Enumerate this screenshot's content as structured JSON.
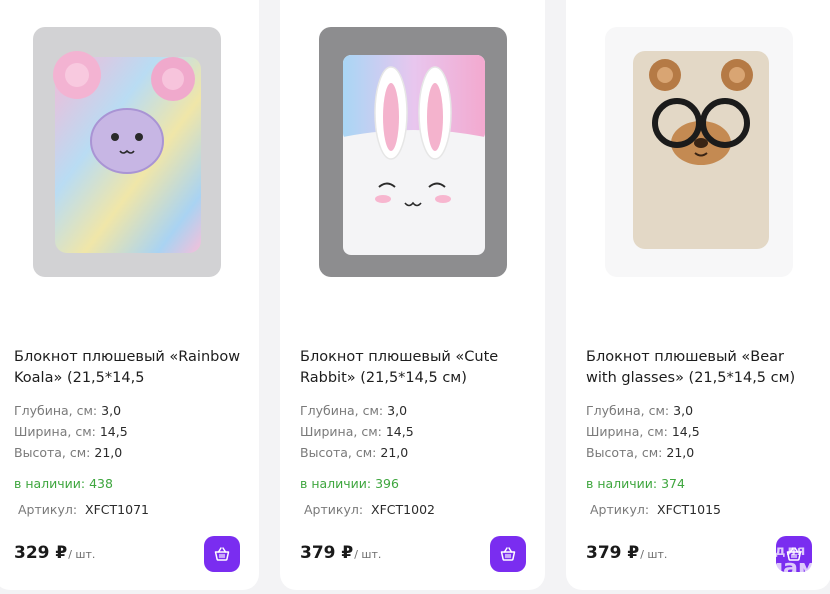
{
  "products": [
    {
      "image_icon": "notebook-rainbow-koala-image",
      "title": "Блокнот плюшевый «Rainbow Koala» (21,5*14,5",
      "specs": [
        {
          "label": "Глубина, см:",
          "value": "3,0"
        },
        {
          "label": "Ширина, см:",
          "value": "14,5"
        },
        {
          "label": "Высота, см:",
          "value": "21,0"
        }
      ],
      "stock": "в наличии: 438",
      "article_label": "Артикул:",
      "article": "XFCT1071",
      "price": "329 ₽",
      "unit": "/ шт."
    },
    {
      "image_icon": "notebook-cute-rabbit-image",
      "title": "Блокнот плюшевый «Cute Rabbit» (21,5*14,5 см)",
      "specs": [
        {
          "label": "Глубина, см:",
          "value": "3,0"
        },
        {
          "label": "Ширина, см:",
          "value": "14,5"
        },
        {
          "label": "Высота, см:",
          "value": "21,0"
        }
      ],
      "stock": "в наличии: 396",
      "article_label": "Артикул:",
      "article": "XFCT1002",
      "price": "379 ₽",
      "unit": "/ шт."
    },
    {
      "image_icon": "notebook-bear-with-glasses-image",
      "title": "Блокнот плюшевый «Bear with glasses» (21,5*14,5 см)",
      "specs": [
        {
          "label": "Глубина, см:",
          "value": "3,0"
        },
        {
          "label": "Ширина, см:",
          "value": "14,5"
        },
        {
          "label": "Высота, см:",
          "value": "21,0"
        }
      ],
      "stock": "в наличии: 374",
      "article_label": "Артикул:",
      "article": "XFCT1015",
      "price": "379 ₽",
      "unit": "/ шт."
    }
  ],
  "cart_icon": "basket-icon",
  "watermark": {
    "top": "для",
    "bottom": "мам"
  },
  "colors": {
    "accent": "#7a2df0",
    "stock": "#3ea63e",
    "background": "#f3f3f5",
    "card": "#ffffff"
  }
}
